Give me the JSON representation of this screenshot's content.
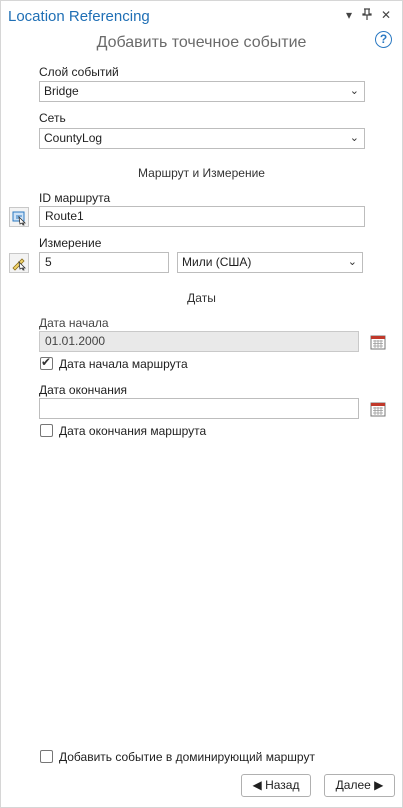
{
  "window": {
    "title": "Location Referencing",
    "menu_glyph": "▾",
    "pin_glyph": "📌",
    "close_glyph": "✕",
    "help_glyph": "?"
  },
  "header": {
    "subtitle": "Добавить точечное событие"
  },
  "event_layer": {
    "label": "Слой событий",
    "value": "Bridge"
  },
  "network": {
    "label": "Сеть",
    "value": "CountyLog"
  },
  "route_section": {
    "title": "Маршрут и Измерение",
    "route_id_label": "ID маршрута",
    "route_id_value": "Route1",
    "measure_label": "Измерение",
    "measure_value": "5",
    "units_value": "Мили (США)"
  },
  "dates": {
    "title": "Даты",
    "start_label": "Дата начала",
    "start_value": "01.01.2000",
    "start_route_checkbox_label": "Дата начала маршрута",
    "start_route_checked": true,
    "end_label": "Дата окончания",
    "end_value": "",
    "end_route_checkbox_label": "Дата окончания маршрута",
    "end_route_checked": false
  },
  "footer": {
    "dominant_route_label": "Добавить событие в доминирующий маршрут",
    "dominant_route_checked": false,
    "back_label": "◀ Назад",
    "next_label": "Далее ▶"
  },
  "colors": {
    "accent": "#1f6fb5",
    "help": "#2b79c2",
    "calendar_red": "#c0392b"
  }
}
